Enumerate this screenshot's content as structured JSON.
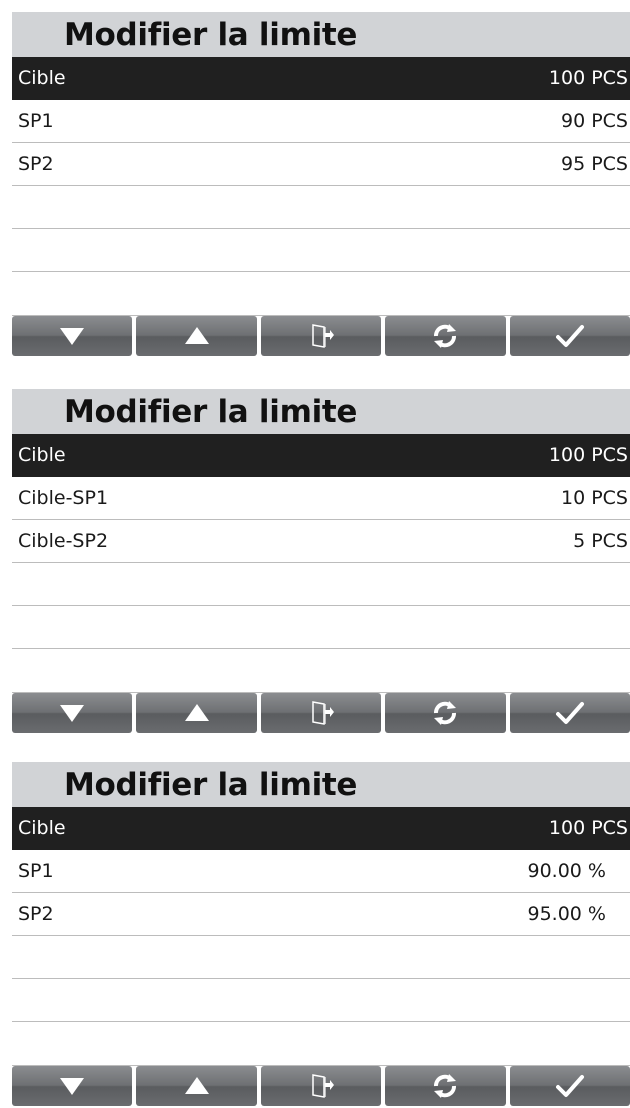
{
  "screens": [
    {
      "title": "Modifier la limite",
      "rows": [
        {
          "label": "Cible",
          "value": "100 PCS",
          "selected": true
        },
        {
          "label": "SP1",
          "value": "90 PCS"
        },
        {
          "label": "SP2",
          "value": "95 PCS"
        },
        {
          "label": "",
          "value": ""
        },
        {
          "label": "",
          "value": ""
        },
        {
          "label": "",
          "value": ""
        }
      ]
    },
    {
      "title": "Modifier la limite",
      "rows": [
        {
          "label": "Cible",
          "value": "100 PCS",
          "selected": true
        },
        {
          "label": "Cible-SP1",
          "value": "10 PCS"
        },
        {
          "label": "Cible-SP2",
          "value": "5 PCS"
        },
        {
          "label": "",
          "value": ""
        },
        {
          "label": "",
          "value": ""
        },
        {
          "label": "",
          "value": ""
        }
      ]
    },
    {
      "title": "Modifier la limite",
      "rows": [
        {
          "label": "Cible",
          "value": "100 PCS",
          "selected": true
        },
        {
          "label": "SP1",
          "value": "90.00 %"
        },
        {
          "label": "SP2",
          "value": "95.00 %"
        },
        {
          "label": "",
          "value": ""
        },
        {
          "label": "",
          "value": ""
        },
        {
          "label": "",
          "value": ""
        }
      ]
    }
  ],
  "toolbar": {
    "buttons": [
      {
        "icon": "triangle-down-icon",
        "action": "down"
      },
      {
        "icon": "triangle-up-icon",
        "action": "up"
      },
      {
        "icon": "exit-door-icon",
        "action": "exit"
      },
      {
        "icon": "refresh-icon",
        "action": "reset"
      },
      {
        "icon": "checkmark-icon",
        "action": "accept"
      }
    ]
  },
  "colors": {
    "title_bar": "#d1d3d6",
    "selected_row": "#202020",
    "button": "#6e7073"
  }
}
